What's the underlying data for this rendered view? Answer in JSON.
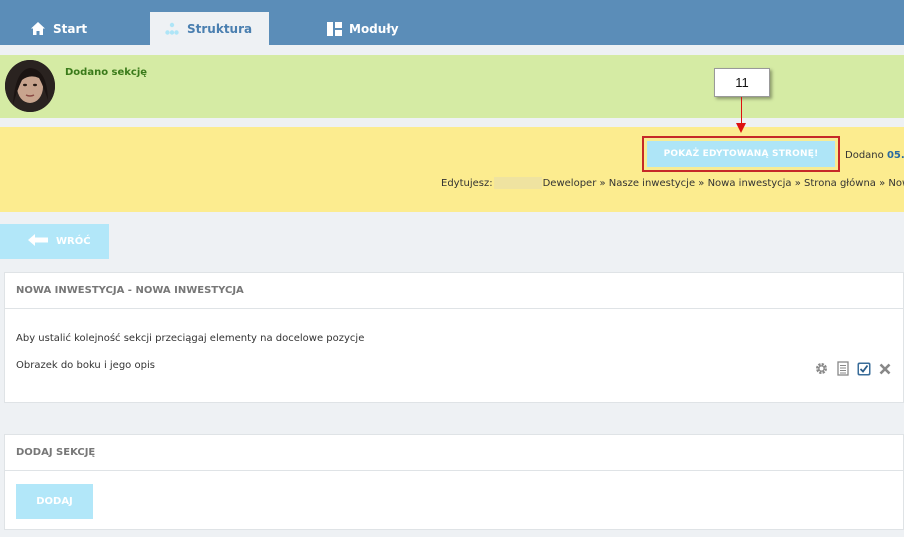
{
  "nav": {
    "tabs": [
      {
        "label": "Start",
        "icon": "home-icon",
        "active": false
      },
      {
        "label": "Struktura",
        "icon": "structure-icon",
        "active": true
      },
      {
        "label": "Moduły",
        "icon": "modules-icon",
        "active": false
      }
    ]
  },
  "notification": {
    "message": "Dodano sekcję",
    "avatar": "avatar"
  },
  "annotation": {
    "callout_number": "11",
    "arrow_color": "#dd1111"
  },
  "editing_bar": {
    "show_page_label": "POKAŻ EDYTOWANĄ STRONĘ!",
    "added_label": "Dodano",
    "added_date": "05.",
    "editing_label": "Edytujesz:",
    "breadcrumb": "Deweloper » Nasze inwestycje » Nowa inwestycja » Strona główna » Nowa"
  },
  "back_button": {
    "label": "WRÓĆ",
    "icon": "arrow-left-icon"
  },
  "sections_panel": {
    "title": "NOWA INWESTYCJA - NOWA INWESTYCJA",
    "hint": "Aby ustalić kolejność sekcji przeciągaj elementy na docelowe pozycje",
    "items": [
      {
        "label": "Obrazek do boku i jego opis",
        "actions": [
          "gear-icon",
          "document-icon",
          "checkbox-icon",
          "close-icon"
        ]
      }
    ]
  },
  "add_panel": {
    "title": "DODAJ SEKCJĘ",
    "button_label": "DODAJ"
  },
  "colors": {
    "nav_bg": "#5b8db8",
    "success_bg": "#d5eba4",
    "warning_bg": "#fcec8f",
    "button_bg": "#b2e7f9",
    "highlight_border": "#c62828"
  }
}
